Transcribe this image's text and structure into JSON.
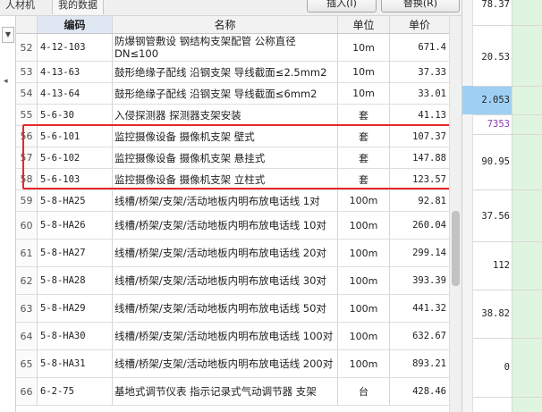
{
  "toolbar": {
    "tab_material": "人材机",
    "tab_my_data": "我的数据",
    "insert_button": "插入(I)",
    "replace_button": "替换(R)"
  },
  "gutter": {
    "dropdown_icon": "chevron-down-icon",
    "arrow_icon": "chevron-left-icon"
  },
  "table": {
    "headers": {
      "code": "编码",
      "name": "名称",
      "unit": "单位",
      "price": "单价"
    },
    "rows": [
      {
        "idx": "52",
        "code": "4-12-103",
        "name": "防爆钢管敷设 钢结构支架配管 公称直径DN≤100",
        "unit": "10m",
        "price": "671.4",
        "h": "r2"
      },
      {
        "idx": "53",
        "code": "4-13-63",
        "name": "鼓形绝缘子配线 沿钢支架 导线截面≤2.5mm2",
        "unit": "10m",
        "price": "37.33",
        "h": "r1"
      },
      {
        "idx": "54",
        "code": "4-13-64",
        "name": "鼓形绝缘子配线 沿钢支架 导线截面≤6mm2",
        "unit": "10m",
        "price": "33.01",
        "h": "r1"
      },
      {
        "idx": "55",
        "code": "5-6-30",
        "name": "入侵探测器 探测器支架安装",
        "unit": "套",
        "price": "41.13",
        "h": "r1"
      },
      {
        "idx": "56",
        "code": "5-6-101",
        "name": "监控摄像设备 摄像机支架 壁式",
        "unit": "套",
        "price": "107.37",
        "h": "r1"
      },
      {
        "idx": "57",
        "code": "5-6-102",
        "name": "监控摄像设备 摄像机支架 悬挂式",
        "unit": "套",
        "price": "147.88",
        "h": "r1"
      },
      {
        "idx": "58",
        "code": "5-6-103",
        "name": "监控摄像设备 摄像机支架 立柱式",
        "unit": "套",
        "price": "123.57",
        "h": "r1"
      },
      {
        "idx": "59",
        "code": "5-8-HA25",
        "name": "线槽/桥架/支架/活动地板内明布放电话线 1对",
        "unit": "100m",
        "price": "92.81",
        "h": "r1"
      },
      {
        "idx": "60",
        "code": "5-8-HA26",
        "name": "线槽/桥架/支架/活动地板内明布放电话线 10对",
        "unit": "100m",
        "price": "260.04",
        "h": "r2"
      },
      {
        "idx": "61",
        "code": "5-8-HA27",
        "name": "线槽/桥架/支架/活动地板内明布放电话线 20对",
        "unit": "100m",
        "price": "299.14",
        "h": "r2"
      },
      {
        "idx": "62",
        "code": "5-8-HA28",
        "name": "线槽/桥架/支架/活动地板内明布放电话线 30对",
        "unit": "100m",
        "price": "393.39",
        "h": "r2"
      },
      {
        "idx": "63",
        "code": "5-8-HA29",
        "name": "线槽/桥架/支架/活动地板内明布放电话线 50对",
        "unit": "100m",
        "price": "441.32",
        "h": "r2"
      },
      {
        "idx": "64",
        "code": "5-8-HA30",
        "name": "线槽/桥架/支架/活动地板内明布放电话线 100对",
        "unit": "100m",
        "price": "632.67",
        "h": "r2"
      },
      {
        "idx": "65",
        "code": "5-8-HA31",
        "name": "线槽/桥架/支架/活动地板内明布放电话线 200对",
        "unit": "100m",
        "price": "893.21",
        "h": "r2"
      },
      {
        "idx": "66",
        "code": "6-2-75",
        "name": "基地式调节仪表 指示记录式气动调节器 支架",
        "unit": "台",
        "price": "428.46",
        "h": "r2"
      }
    ]
  },
  "right_panel": {
    "values": [
      "78.37",
      "20.53",
      "2.053",
      "7353",
      "90.95",
      "37.56",
      "112",
      "38.82",
      "0"
    ]
  }
}
